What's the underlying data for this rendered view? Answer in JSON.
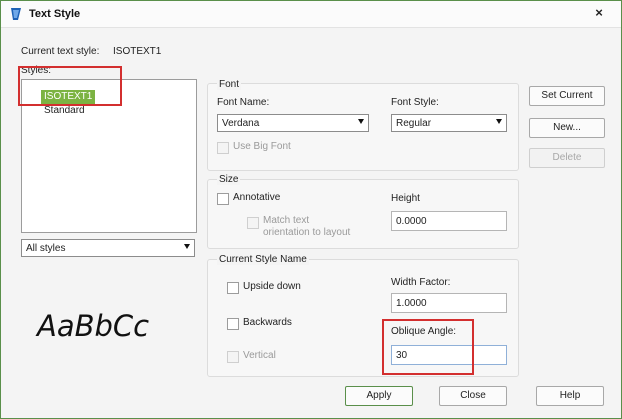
{
  "window": {
    "title": "Text Style",
    "close_glyph": "×"
  },
  "current_style": {
    "label": "Current text style:",
    "value": "ISOTEXT1"
  },
  "styles": {
    "label": "Styles:",
    "items": [
      {
        "label": "ISOTEXT1",
        "selected": true
      },
      {
        "label": "Standard",
        "selected": false
      }
    ],
    "filter_value": "All styles"
  },
  "preview": {
    "text": "AaBbCc"
  },
  "font": {
    "group_label": "Font",
    "name_label": "Font Name:",
    "name_value": "Verdana",
    "style_label": "Font Style:",
    "style_value": "Regular",
    "big_font_label": "Use Big Font"
  },
  "size": {
    "group_label": "Size",
    "annotative_label": "Annotative",
    "match_line1": "Match text",
    "match_line2": "orientation to layout",
    "height_label": "Height",
    "height_value": "0.0000"
  },
  "effects": {
    "group_label": "Current Style Name",
    "upside_down_label": "Upside down",
    "backwards_label": "Backwards",
    "vertical_label": "Vertical",
    "width_label": "Width Factor:",
    "width_value": "1.0000",
    "oblique_label": "Oblique Angle:",
    "oblique_value": "30"
  },
  "buttons": {
    "set_current": "Set Current",
    "new": "New...",
    "delete": "Delete",
    "apply": "Apply",
    "close": "Close",
    "help": "Help"
  },
  "colors": {
    "selection": "#7cb342",
    "highlight_box": "#d32f2f",
    "frame": "#5a8f4a"
  }
}
